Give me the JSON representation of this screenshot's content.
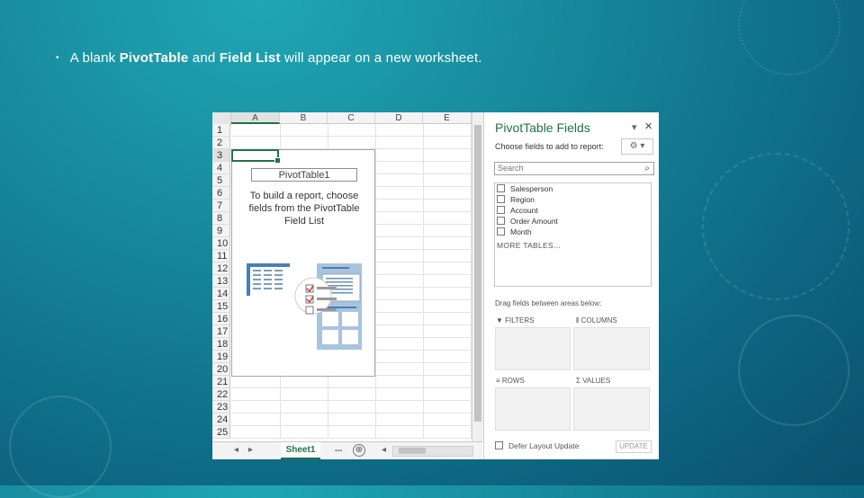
{
  "slide": {
    "bullet_prefix": "A blank ",
    "bullet_bold1": "PivotTable",
    "bullet_mid": " and ",
    "bullet_bold2": "Field List",
    "bullet_suffix": " will appear on a new worksheet."
  },
  "spreadsheet": {
    "columns": [
      "A",
      "B",
      "C",
      "D",
      "E"
    ],
    "rows": [
      "1",
      "2",
      "3",
      "4",
      "5",
      "6",
      "7",
      "8",
      "9",
      "10",
      "11",
      "12",
      "13",
      "14",
      "15",
      "16",
      "17",
      "18",
      "19",
      "20",
      "21",
      "22",
      "23",
      "24",
      "25"
    ],
    "pivot_name": "PivotTable1",
    "pivot_instructions": "To build a report, choose fields from the PivotTable Field List",
    "sheet_tab": "Sheet1",
    "more_tabs": "...",
    "add_sheet": "⊕"
  },
  "field_pane": {
    "title": "PivotTable Fields",
    "choose_label": "Choose fields to add to report:",
    "search_placeholder": "Search",
    "fields": [
      "Salesperson",
      "Region",
      "Account",
      "Order Amount",
      "Month"
    ],
    "more_tables": "MORE TABLES...",
    "drag_label": "Drag fields between areas below:",
    "areas": [
      "FILTERS",
      "COLUMNS",
      "ROWS",
      "VALUES"
    ],
    "defer_label": "Defer Layout Update",
    "update_label": "UPDATE"
  },
  "colors": {
    "accent": "#217346",
    "background": "#17899c"
  }
}
